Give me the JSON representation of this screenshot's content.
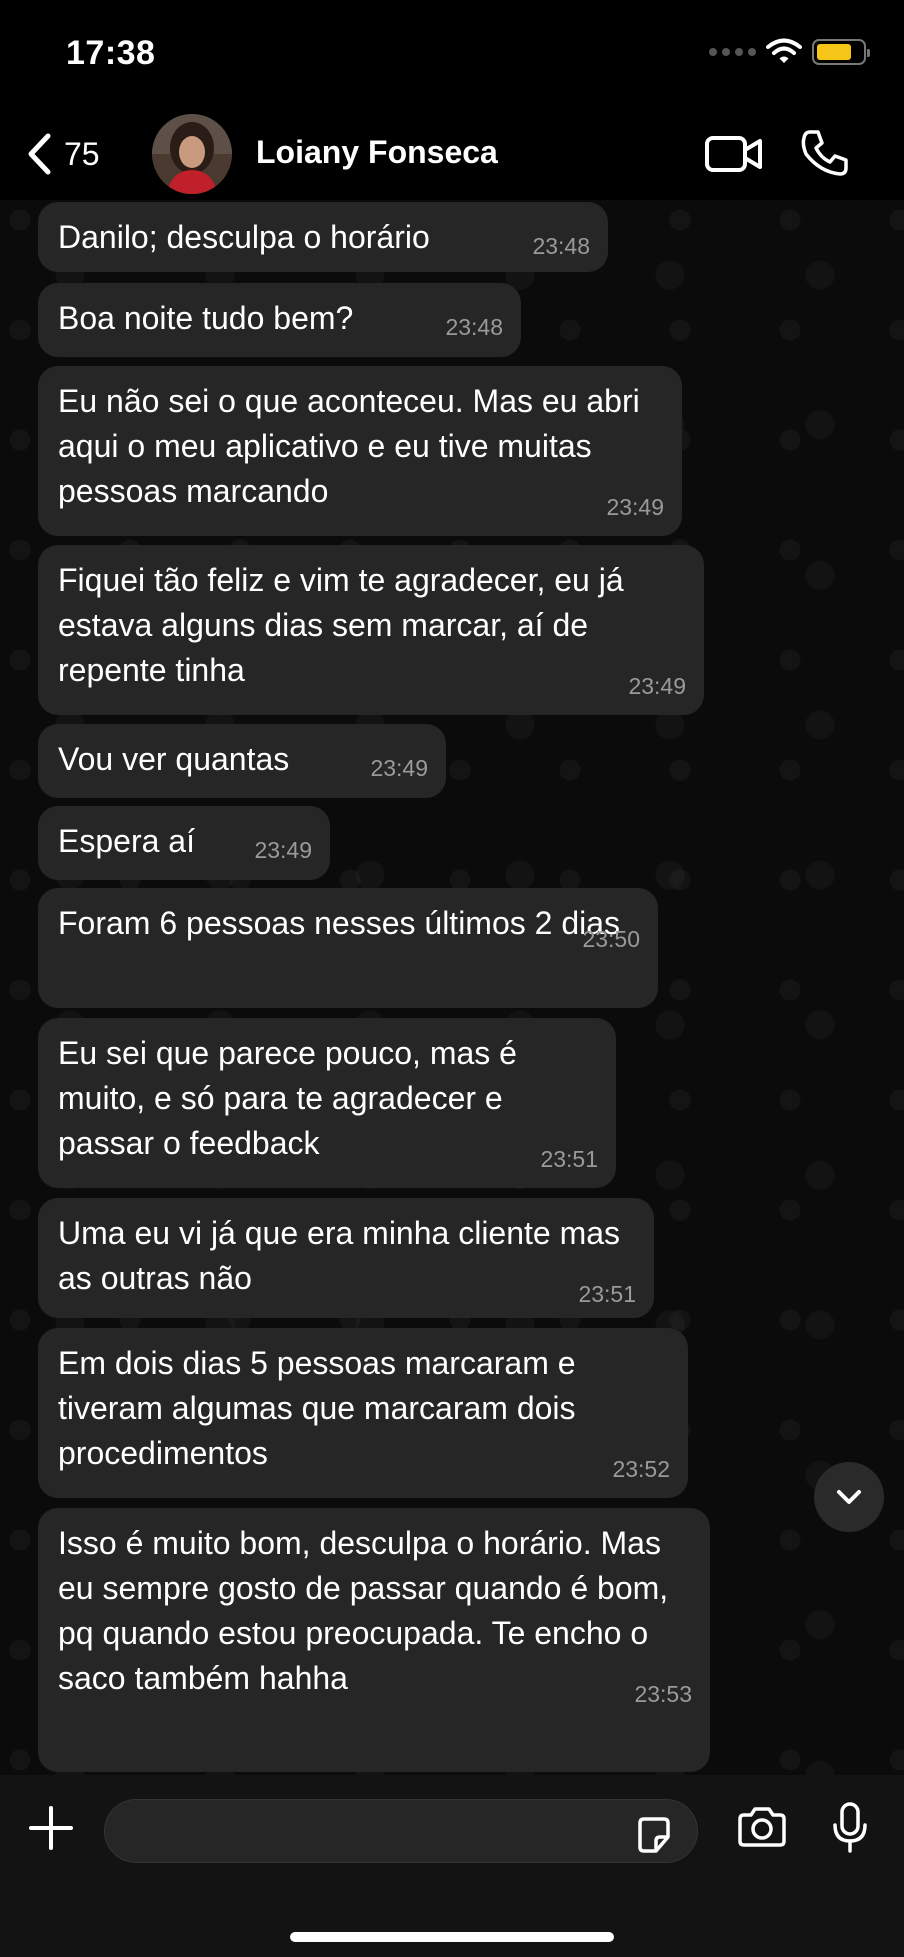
{
  "status": {
    "time": "17:38"
  },
  "header": {
    "back_count": "75",
    "contact_name": "Loiany Fonseca"
  },
  "messages": [
    {
      "text": "Danilo; desculpa o horário",
      "time": "23:48"
    },
    {
      "text": "Boa noite tudo bem?",
      "time": "23:48"
    },
    {
      "text": "Eu não sei o que aconteceu. Mas eu abri aqui o meu aplicativo e eu tive muitas pessoas marcando",
      "time": "23:49"
    },
    {
      "text": "Fiquei tão feliz e vim te agradecer, eu já estava alguns dias sem marcar, aí de repente tinha",
      "time": "23:49"
    },
    {
      "text": "Vou ver quantas",
      "time": "23:49"
    },
    {
      "text": "Espera aí",
      "time": "23:49"
    },
    {
      "text": "Foram 6 pessoas nesses últimos 2 dias",
      "time": "23:50"
    },
    {
      "text": "Eu sei que parece pouco, mas é muito, e só para te agradecer e passar o feedback",
      "time": "23:51"
    },
    {
      "text": "Uma eu vi já que era minha cliente mas as outras não",
      "time": "23:51"
    },
    {
      "text": "Em dois dias 5 pessoas marcaram e tiveram algumas que marcaram dois procedimentos",
      "time": "23:52"
    },
    {
      "text": "Isso é muito bom, desculpa o horário. Mas eu sempre gosto de passar quando é bom, pq quando estou preocupada. Te encho o saco também hahha",
      "time": "23:53"
    }
  ],
  "input": {
    "value": "",
    "placeholder": ""
  },
  "colors": {
    "bubble": "#262626",
    "background": "#0b0b0b",
    "battery": "#f5c518"
  },
  "icons": [
    "back-chevron-icon",
    "video-camera-icon",
    "phone-icon",
    "plus-icon",
    "sticker-icon",
    "camera-icon",
    "microphone-icon",
    "chevron-down-icon",
    "wifi-icon",
    "battery-icon"
  ]
}
